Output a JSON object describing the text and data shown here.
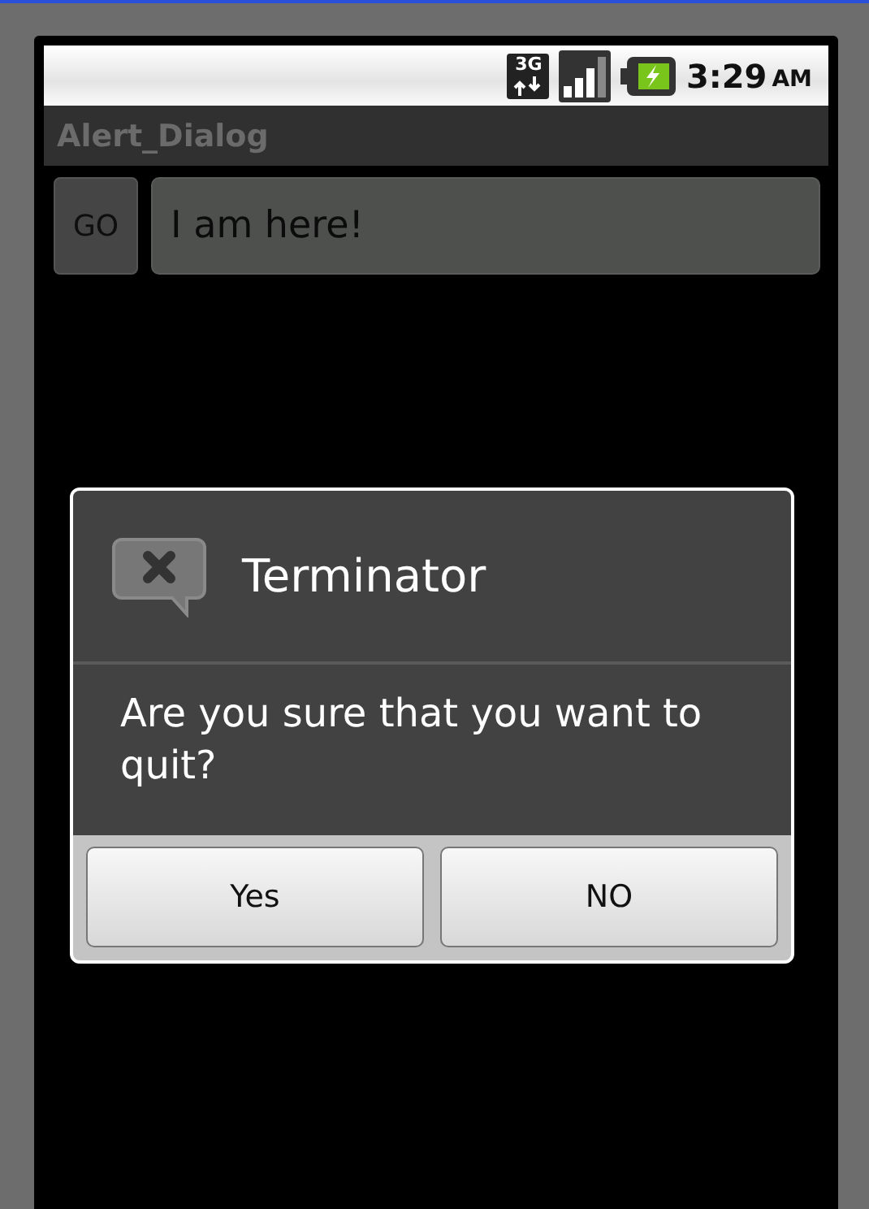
{
  "status_bar": {
    "network": "3G",
    "time": "3:29",
    "meridiem": "AM"
  },
  "app": {
    "title": "Alert_Dialog",
    "go_button": "GO",
    "text_field": {
      "value": "I am here!"
    }
  },
  "dialog": {
    "title": "Terminator",
    "message": "Are you sure that you want to quit?",
    "buttons": [
      "Yes",
      "NO"
    ]
  }
}
